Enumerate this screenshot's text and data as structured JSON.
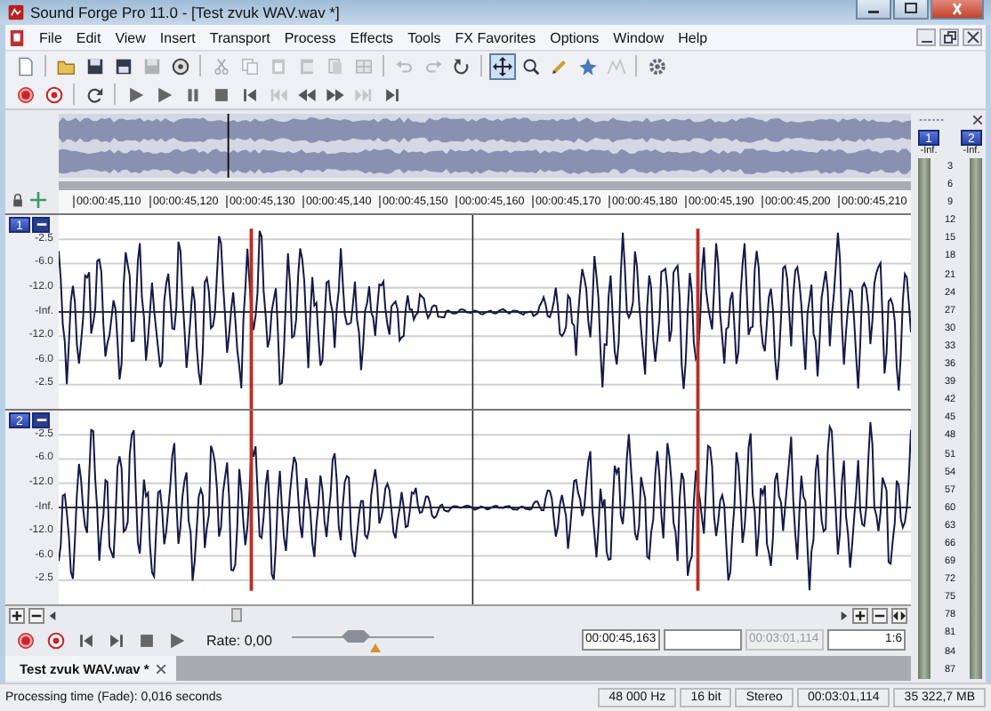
{
  "window": {
    "title": "Sound Forge Pro 11.0 - [Test zvuk WAV.wav *]"
  },
  "menu": [
    "File",
    "Edit",
    "View",
    "Insert",
    "Transport",
    "Process",
    "Effects",
    "Tools",
    "FX Favorites",
    "Options",
    "Window",
    "Help"
  ],
  "toolbar": [
    {
      "kind": "new",
      "disabled": false,
      "selected": false
    },
    {
      "kind": "separator"
    },
    {
      "kind": "open",
      "disabled": false,
      "selected": false
    },
    {
      "kind": "save",
      "disabled": false,
      "selected": false
    },
    {
      "kind": "save-as",
      "disabled": false,
      "selected": false
    },
    {
      "kind": "save-all",
      "disabled": true,
      "selected": false
    },
    {
      "kind": "render",
      "disabled": false,
      "selected": false
    },
    {
      "kind": "separator"
    },
    {
      "kind": "cut",
      "disabled": true,
      "selected": false
    },
    {
      "kind": "copy",
      "disabled": true,
      "selected": false
    },
    {
      "kind": "paste",
      "disabled": true,
      "selected": false
    },
    {
      "kind": "mix",
      "disabled": true,
      "selected": false
    },
    {
      "kind": "crop",
      "disabled": true,
      "selected": false
    },
    {
      "kind": "trim",
      "disabled": true,
      "selected": false
    },
    {
      "kind": "separator"
    },
    {
      "kind": "undo",
      "disabled": true,
      "selected": false
    },
    {
      "kind": "redo",
      "disabled": true,
      "selected": false
    },
    {
      "kind": "repeat",
      "disabled": false,
      "selected": false
    },
    {
      "kind": "separator"
    },
    {
      "kind": "edit-tool",
      "disabled": false,
      "selected": true
    },
    {
      "kind": "zoom",
      "disabled": false,
      "selected": false
    },
    {
      "kind": "pencil",
      "disabled": false,
      "selected": false
    },
    {
      "kind": "event",
      "disabled": false,
      "selected": false
    },
    {
      "kind": "envelope",
      "disabled": true,
      "selected": false
    },
    {
      "kind": "separator"
    },
    {
      "kind": "plugin",
      "disabled": false,
      "selected": false
    }
  ],
  "transport_toolbar": [
    {
      "kind": "record",
      "disabled": false
    },
    {
      "kind": "record-arm",
      "disabled": false
    },
    {
      "kind": "separator"
    },
    {
      "kind": "loop",
      "disabled": false
    },
    {
      "kind": "separator"
    },
    {
      "kind": "play-all",
      "disabled": false
    },
    {
      "kind": "play",
      "disabled": false
    },
    {
      "kind": "pause",
      "disabled": false
    },
    {
      "kind": "stop",
      "disabled": false
    },
    {
      "kind": "go-start",
      "disabled": false
    },
    {
      "kind": "prev-marker",
      "disabled": true
    },
    {
      "kind": "rewind",
      "disabled": false
    },
    {
      "kind": "forward",
      "disabled": false
    },
    {
      "kind": "next-marker",
      "disabled": true
    },
    {
      "kind": "go-end",
      "disabled": false
    }
  ],
  "ruler": [
    "00:00:45,110",
    "00:00:45,120",
    "00:00:45,130",
    "00:00:45,140",
    "00:00:45,150",
    "00:00:45,160",
    "00:00:45,170",
    "00:00:45,180",
    "00:00:45,190",
    "00:00:45,200",
    "00:00:45,210"
  ],
  "channels": [
    {
      "number": "1",
      "scale": [
        "-2.5",
        "-6.0",
        "-12.0",
        "-Inf.",
        "-12.0",
        "-6.0",
        "-2.5"
      ]
    },
    {
      "number": "2",
      "scale": [
        "-2.5",
        "-6.0",
        "-12.0",
        "-Inf.",
        "-12.0",
        "-6.0",
        "-2.5"
      ]
    }
  ],
  "meter": {
    "channels": [
      {
        "number": "1",
        "peak": "-Inf."
      },
      {
        "number": "2",
        "peak": "-Inf."
      }
    ],
    "scale": [
      "3",
      "6",
      "9",
      "12",
      "15",
      "18",
      "21",
      "24",
      "27",
      "30",
      "33",
      "36",
      "39",
      "42",
      "45",
      "48",
      "51",
      "54",
      "57",
      "60",
      "63",
      "66",
      "69",
      "72",
      "75",
      "78",
      "81",
      "84",
      "87"
    ]
  },
  "transport": {
    "buttons": [
      {
        "kind": "record",
        "disabled": false
      },
      {
        "kind": "record-arm",
        "disabled": false
      },
      {
        "kind": "go-start",
        "disabled": false
      },
      {
        "kind": "go-end",
        "disabled": false
      },
      {
        "kind": "stop",
        "disabled": false
      },
      {
        "kind": "play",
        "disabled": false
      }
    ],
    "rate": "Rate: 0,00",
    "rate_slider": {
      "level": 0.45
    },
    "fields": [
      {
        "value": "00:00:45,163",
        "disabled": false
      },
      {
        "disabled": false
      },
      {
        "value": "00:03:01,114",
        "disabled": true
      },
      {
        "value": "1:6",
        "disabled": false
      }
    ]
  },
  "tabs": [
    {
      "label": "Test zvuk WAV.wav *",
      "selected": true
    }
  ],
  "status_bar": {
    "message": "Processing time (Fade): 0,016 seconds",
    "cells": [
      "48 000 Hz",
      "16 bit",
      "Stereo",
      "00:03:01,114",
      "35 322,7 MB"
    ]
  }
}
